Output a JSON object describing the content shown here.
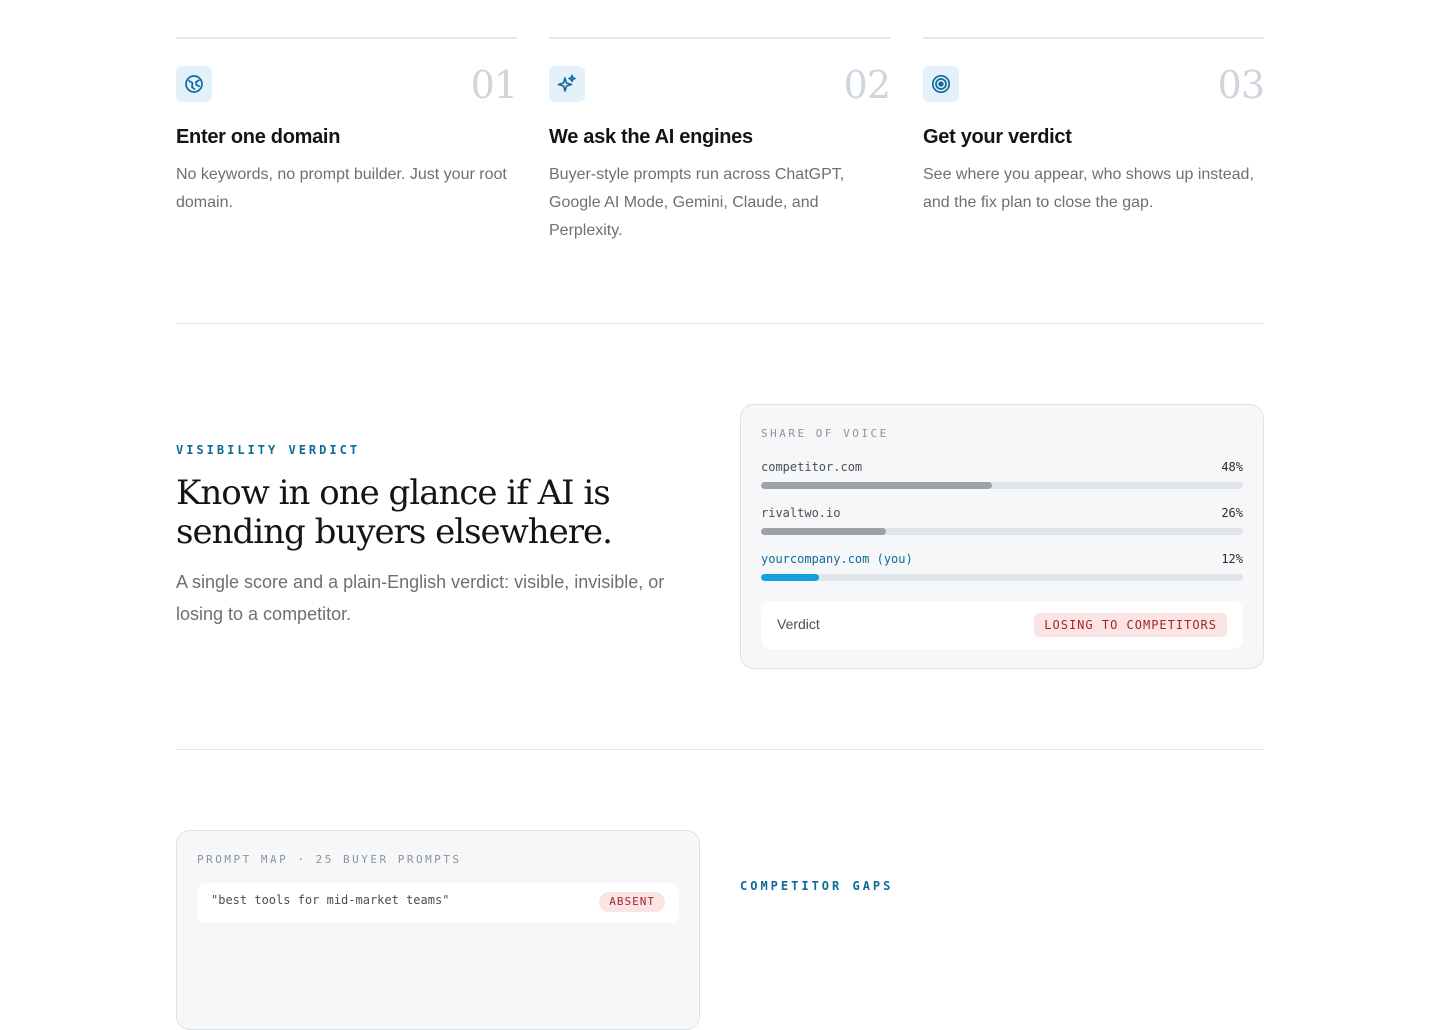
{
  "steps": [
    {
      "icon": "globe-icon",
      "number": "01",
      "title": "Enter one domain",
      "description": "No keywords, no prompt builder. Just your root domain."
    },
    {
      "icon": "sparkles-icon",
      "number": "02",
      "title": "We ask the AI engines",
      "description": "Buyer-style prompts run across ChatGPT, Google AI Mode, Gemini, Claude, and Perplexity."
    },
    {
      "icon": "target-icon",
      "number": "03",
      "title": "Get your verdict",
      "description": "See where you appear, who shows up instead, and the fix plan to close the gap."
    }
  ],
  "verdict_section": {
    "eyebrow": "VISIBILITY VERDICT",
    "headline": "Know in one glance if AI is sending buyers elsewhere.",
    "lede": "A single score and a plain-English verdict: visible, invisible, or losing to a competitor."
  },
  "share_of_voice": {
    "label": "SHARE OF VOICE",
    "rows": [
      {
        "name": "competitor.com",
        "percent_label": "48%",
        "value": 48,
        "is_you": false
      },
      {
        "name": "rivaltwo.io",
        "percent_label": "26%",
        "value": 26,
        "is_you": false
      },
      {
        "name": "yourcompany.com (you)",
        "percent_label": "12%",
        "value": 12,
        "is_you": true
      }
    ],
    "verdict_label": "Verdict",
    "verdict_badge": "LOSING TO COMPETITORS"
  },
  "prompt_map": {
    "label": "PROMPT MAP · 25 BUYER PROMPTS",
    "first_prompt": "\"best tools for mid-market teams\"",
    "first_tag": "ABSENT"
  },
  "competitor_gaps": {
    "eyebrow": "COMPETITOR GAPS"
  },
  "colors": {
    "accent": "#0f6a9a",
    "you_bar": "#14a0e0",
    "competitor_bar": "#9ea2a7",
    "badge_bg": "#fbe4e4",
    "badge_text": "#a3252a"
  }
}
